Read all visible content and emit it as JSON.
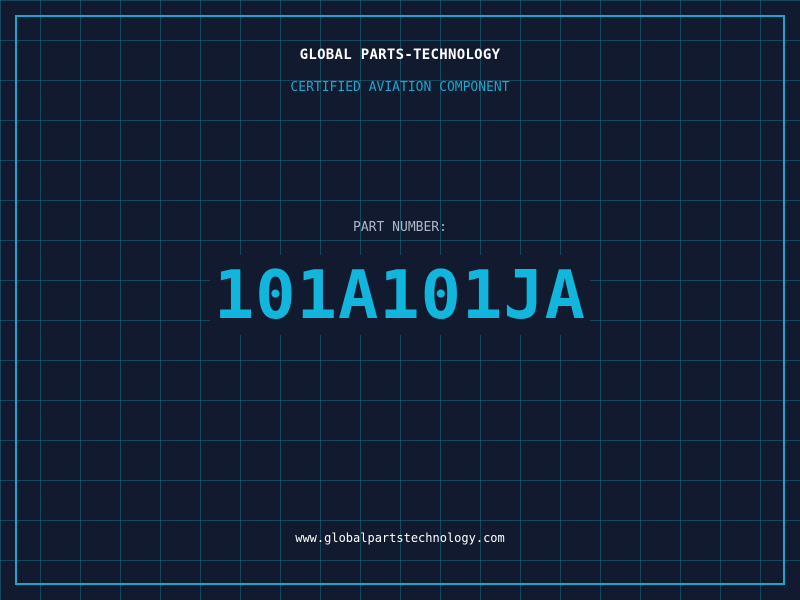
{
  "header": {
    "company_name": "GLOBAL PARTS-TECHNOLOGY",
    "subtitle": "CERTIFIED AVIATION COMPONENT"
  },
  "part": {
    "label": "PART NUMBER:",
    "number": "101A101JA"
  },
  "footer": {
    "website": "www.globalpartstechnology.com"
  },
  "colors": {
    "background": "#111a2e",
    "grid": "#186e84",
    "accent": "#1aa7cf",
    "part_number": "#12b5dc",
    "label": "#aeb8c8",
    "text": "#ffffff"
  }
}
